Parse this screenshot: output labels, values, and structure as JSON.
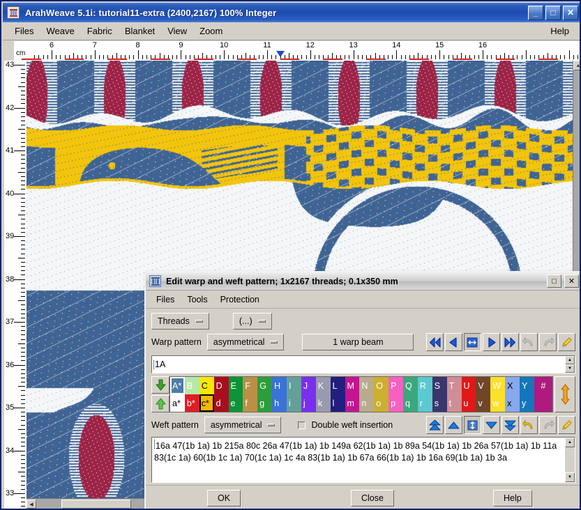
{
  "window": {
    "title": "ArahWeave 5.1i: tutorial11-extra (2400,2167) 100% Integer",
    "icon": "loom-icon",
    "buttons": {
      "minimize": "_",
      "maximize": "□",
      "close": "✕"
    }
  },
  "menubar": {
    "items": [
      {
        "label": "Files"
      },
      {
        "label": "Weave"
      },
      {
        "label": "Fabric"
      },
      {
        "label": "Blanket"
      },
      {
        "label": "View"
      },
      {
        "label": "Zoom"
      }
    ],
    "help": "Help"
  },
  "rulers": {
    "unit": "cm",
    "top": {
      "labels": [
        "6",
        "7",
        "8",
        "9",
        "10",
        "11",
        "12",
        "13",
        "14",
        "15",
        "16"
      ],
      "marker_value": "11.3"
    },
    "left": {
      "labels": [
        "43",
        "42",
        "41",
        "40",
        "39",
        "38",
        "37",
        "36",
        "35",
        "34",
        "33"
      ]
    }
  },
  "fabric": {
    "colors": {
      "blue": "#3d6494",
      "gold": "#f2c40c",
      "white": "#f4f6f8",
      "maroon": "#9c2346",
      "dot": "#ffffff",
      "red_dot": "#e04a6a"
    }
  },
  "dialog": {
    "title": "Edit warp and weft pattern; 1x2167 threads; 0.1x350 mm",
    "icon": "pattern-icon",
    "buttons": {
      "maximize": "□",
      "close": "✕"
    },
    "menubar": [
      {
        "label": "Files"
      },
      {
        "label": "Tools"
      },
      {
        "label": "Protection"
      }
    ],
    "toolbar": {
      "threads_label": "Threads",
      "ellipsis_label": "(...)"
    },
    "warp": {
      "label": "Warp pattern",
      "symmetry": "asymmetrical",
      "beam": "1 warp beam",
      "pattern_value": "1A",
      "nav_buttons": [
        {
          "name": "first",
          "glyph": "«"
        },
        {
          "name": "previous",
          "glyph": "◀"
        },
        {
          "name": "fit",
          "glyph": "↔"
        },
        {
          "name": "next",
          "glyph": "▶"
        },
        {
          "name": "last",
          "glyph": "»"
        },
        {
          "name": "undo",
          "glyph": "↶"
        },
        {
          "name": "redo",
          "glyph": "↷"
        },
        {
          "name": "clear",
          "glyph": "✐"
        }
      ]
    },
    "palette": {
      "uppercase": [
        {
          "label": "A*",
          "color": "#4e7ca8",
          "text": "#ffffff"
        },
        {
          "label": "B",
          "color": "#b8e8a8",
          "text": "#ffffff"
        },
        {
          "label": "C",
          "color": "#f5e800",
          "text": "#000000"
        },
        {
          "label": "D",
          "color": "#a80f1e",
          "text": "#ffffff"
        },
        {
          "label": "E",
          "color": "#0b9438",
          "text": "#ffffff"
        },
        {
          "label": "F",
          "color": "#bb9044",
          "text": "#ffffff"
        },
        {
          "label": "G",
          "color": "#2c9d3c",
          "text": "#ffffff"
        },
        {
          "label": "H",
          "color": "#3a72d8",
          "text": "#ffffff"
        },
        {
          "label": "I",
          "color": "#63a099",
          "text": "#ffffff"
        },
        {
          "label": "J",
          "color": "#7a2ef0",
          "text": "#ffffff"
        },
        {
          "label": "K",
          "color": "#9a9aae",
          "text": "#ffffff"
        },
        {
          "label": "L",
          "color": "#211e7e",
          "text": "#ffffff"
        },
        {
          "label": "M",
          "color": "#c41491",
          "text": "#ffffff"
        },
        {
          "label": "N",
          "color": "#b8ab8e",
          "text": "#ffffff"
        },
        {
          "label": "O",
          "color": "#cbb02f",
          "text": "#ffffff"
        },
        {
          "label": "P",
          "color": "#f660c0",
          "text": "#ffffff"
        },
        {
          "label": "Q",
          "color": "#3aa87c",
          "text": "#ffffff"
        },
        {
          "label": "R",
          "color": "#5cc8d0",
          "text": "#ffffff"
        },
        {
          "label": "S",
          "color": "#3b356e",
          "text": "#ffffff"
        },
        {
          "label": "T",
          "color": "#cf8e96",
          "text": "#ffffff"
        },
        {
          "label": "U",
          "color": "#e01818",
          "text": "#ffffff"
        },
        {
          "label": "V",
          "color": "#70452a",
          "text": "#ffffff"
        },
        {
          "label": "W",
          "color": "#fce02c",
          "text": "#ffffff"
        },
        {
          "label": "X",
          "color": "#87a8ee",
          "text": "#000000"
        },
        {
          "label": "Y",
          "color": "#1477bb",
          "text": "#ffffff"
        }
      ],
      "lowercase": [
        {
          "label": "a*",
          "color": "#ffffff",
          "text": "#000000"
        },
        {
          "label": "b*",
          "color": "#e01c24",
          "text": "#ffffff"
        },
        {
          "label": "c*",
          "color": "#f5b800",
          "text": "#000000"
        },
        {
          "label": "d",
          "color": "#a80f1e",
          "text": "#ffffff"
        },
        {
          "label": "e",
          "color": "#0b9438",
          "text": "#ffffff"
        },
        {
          "label": "f",
          "color": "#bb9044",
          "text": "#ffffff"
        },
        {
          "label": "g",
          "color": "#2c9d3c",
          "text": "#ffffff"
        },
        {
          "label": "h",
          "color": "#3a72d8",
          "text": "#ffffff"
        },
        {
          "label": "i",
          "color": "#63a099",
          "text": "#ffffff"
        },
        {
          "label": "j",
          "color": "#7a2ef0",
          "text": "#ffffff"
        },
        {
          "label": "k",
          "color": "#9a9aae",
          "text": "#ffffff"
        },
        {
          "label": "l",
          "color": "#211e7e",
          "text": "#ffffff"
        },
        {
          "label": "m",
          "color": "#c41491",
          "text": "#ffffff"
        },
        {
          "label": "n",
          "color": "#b8ab8e",
          "text": "#ffffff"
        },
        {
          "label": "o",
          "color": "#cbb02f",
          "text": "#ffffff"
        },
        {
          "label": "p",
          "color": "#f660c0",
          "text": "#ffffff"
        },
        {
          "label": "q",
          "color": "#3aa87c",
          "text": "#ffffff"
        },
        {
          "label": "r",
          "color": "#5cc8d0",
          "text": "#ffffff"
        },
        {
          "label": "s",
          "color": "#3b356e",
          "text": "#ffffff"
        },
        {
          "label": "t",
          "color": "#cf8e96",
          "text": "#ffffff"
        },
        {
          "label": "u",
          "color": "#e01818",
          "text": "#ffffff"
        },
        {
          "label": "v",
          "color": "#70452a",
          "text": "#ffffff"
        },
        {
          "label": "w",
          "color": "#fce02c",
          "text": "#ffffff"
        },
        {
          "label": "x",
          "color": "#87a8ee",
          "text": "#000000"
        },
        {
          "label": "y",
          "color": "#1477bb",
          "text": "#ffffff"
        }
      ],
      "hash_label": "#",
      "hash_color": "#b0197e",
      "add_warp_icon": "green-down-arrow-icon",
      "add_weft_icon": "green-up-arrow-icon",
      "resize_icon": "orange-updown-arrow-icon"
    },
    "weft": {
      "label": "Weft pattern",
      "symmetry": "asymmetrical",
      "double_insertion_label": "Double weft insertion",
      "double_insertion_checked": false,
      "pattern_value": "16a 47(1b 1a) 1b 215a 80c 26a 47(1b 1a) 1b 149a 62(1b 1a) 1b 89a 54(1b 1a) 1b 26a 57(1b 1a) 1b 11a 83(1c 1a) 60(1b 1c 1a) 70(1c 1a) 1c 4a 83(1b 1a) 1b 67a 66(1b 1a) 1b 16a 69(1b 1a) 1b 3a",
      "nav_buttons": [
        {
          "name": "top",
          "glyph": "▲"
        },
        {
          "name": "up",
          "glyph": "△"
        },
        {
          "name": "fit-vertical",
          "glyph": "↕"
        },
        {
          "name": "down",
          "glyph": "▽"
        },
        {
          "name": "bottom",
          "glyph": "▼"
        },
        {
          "name": "undo",
          "glyph": "↶"
        },
        {
          "name": "redo",
          "glyph": "↷"
        },
        {
          "name": "clear",
          "glyph": "✐"
        }
      ]
    },
    "footer": {
      "ok": "OK",
      "close": "Close",
      "help": "Help"
    }
  }
}
